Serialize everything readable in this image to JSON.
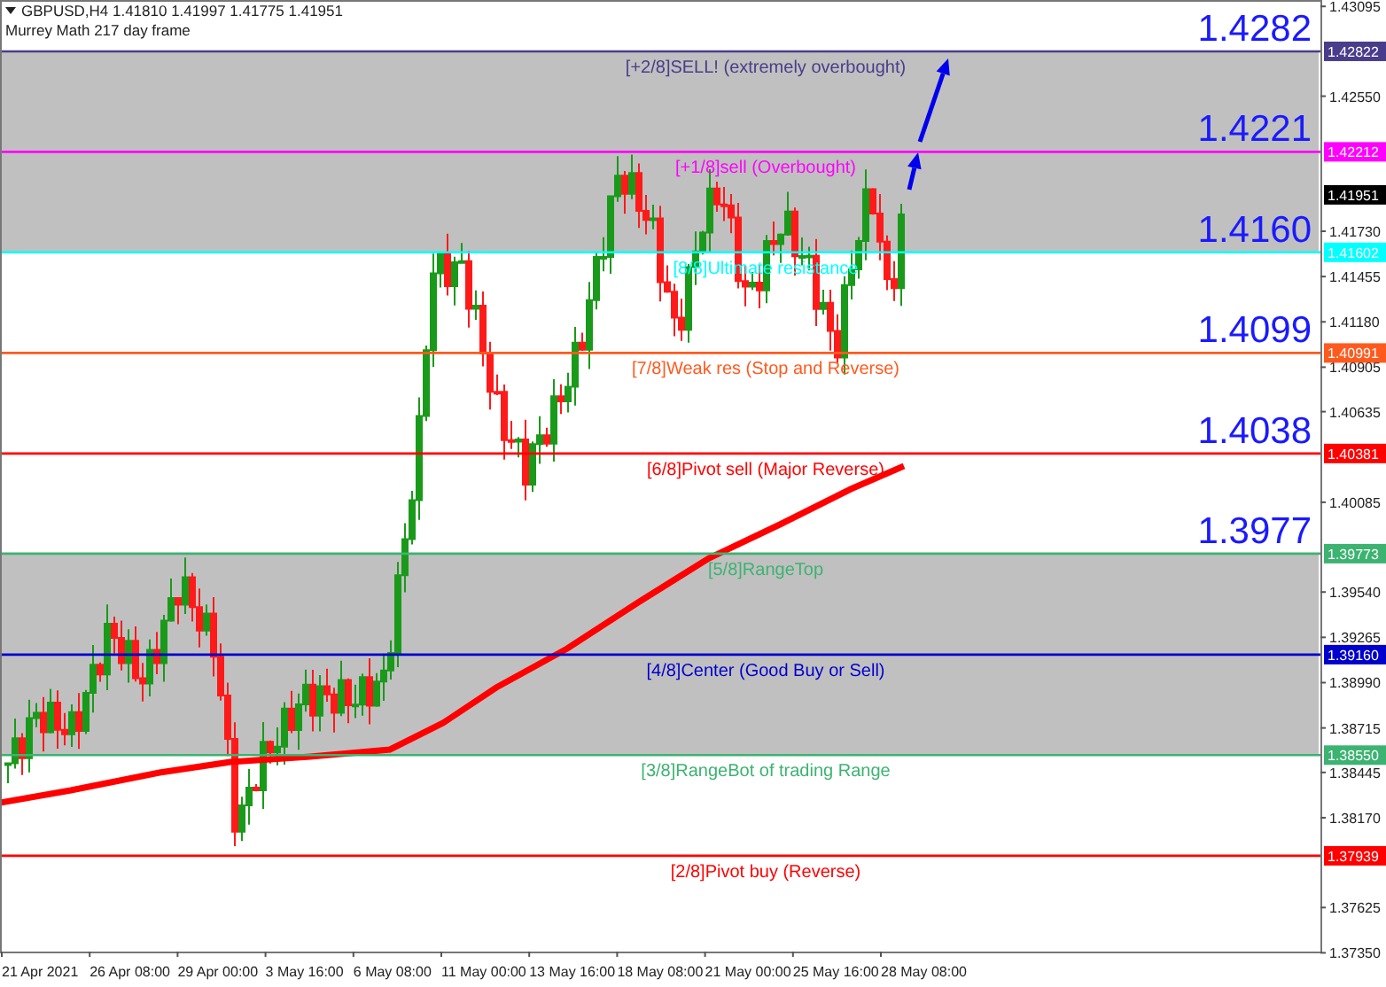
{
  "header": {
    "symbol": "GBPUSD,H4",
    "quotes": [
      "1.41810",
      "1.41997",
      "1.41775",
      "1.41951"
    ],
    "indicator": "Murrey Math 217 day frame"
  },
  "levels": [
    {
      "label": "[+2/8]SELL! (extremely overbought)",
      "price": "1.42822",
      "big_label": "1.4282",
      "color": "#483d8b",
      "shaded_below": true
    },
    {
      "label": "[+1/8]sell (Overbought)",
      "price": "1.42212",
      "big_label": "1.4221",
      "color": "#ff00ff",
      "shaded_below": true
    },
    {
      "label": "[8/8]Ultimate resistance",
      "price": "1.41602",
      "big_label": "1.4160",
      "color": "#00ffff",
      "shaded_below": false
    },
    {
      "label": "[7/8]Weak res (Stop and Reverse)",
      "price": "1.40991",
      "big_label": "1.4099",
      "color": "#ff5a1e",
      "shaded_below": false
    },
    {
      "label": "[6/8]Pivot sell (Major Reverse)",
      "price": "1.40381",
      "big_label": "1.4038",
      "color": "#ff0000",
      "shaded_below": false
    },
    {
      "label": "[5/8]RangeTop",
      "price": "1.39773",
      "big_label": "1.3977",
      "color": "#3cb371",
      "shaded_below": true
    },
    {
      "label": "[4/8]Center (Good Buy or Sell)",
      "price": "1.39160",
      "color": "#0000cd",
      "shaded_below": true
    },
    {
      "label": "[3/8]RangeBot of trading Range",
      "price": "1.38550",
      "color": "#3cb371",
      "shaded_below": false
    },
    {
      "label": "[2/8]Pivot buy (Reverse)",
      "price": "1.37939",
      "color": "#ff0000",
      "shaded_below": false
    }
  ],
  "current_price": "1.41951",
  "price_ticks": [
    "1.43095",
    "1.42550",
    "1.41730",
    "1.41455",
    "1.41180",
    "1.40905",
    "1.40635",
    "1.40085",
    "1.39540",
    "1.39265",
    "1.38990",
    "1.38715",
    "1.38445",
    "1.38170",
    "1.37625",
    "1.37350"
  ],
  "time_ticks": [
    "21 Apr 2021",
    "26 Apr 08:00",
    "29 Apr 00:00",
    "3 May 16:00",
    "6 May 08:00",
    "11 May 00:00",
    "13 May 16:00",
    "18 May 08:00",
    "21 May 00:00",
    "25 May 16:00",
    "28 May 08:00"
  ]
}
